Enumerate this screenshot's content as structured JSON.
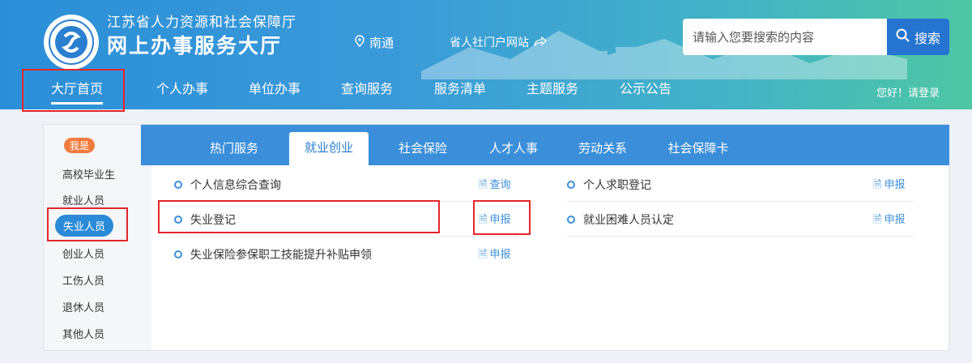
{
  "header": {
    "org_name": "江苏省人力资源和社会保障厅",
    "site_name": "网上办事服务大厅",
    "location": "南通",
    "portal_link": "省人社门户网站",
    "login_text": "您好！请登录"
  },
  "search": {
    "placeholder": "请输入您要搜索的内容",
    "button_label": "搜索"
  },
  "nav": {
    "items": [
      "大厅首页",
      "个人办事",
      "单位办事",
      "查询服务",
      "服务清单",
      "主题服务",
      "公示公告"
    ]
  },
  "sidebar": {
    "badge": "我是",
    "items": [
      "高校毕业生",
      "就业人员",
      "失业人员",
      "创业人员",
      "工伤人员",
      "退休人员",
      "其他人员"
    ]
  },
  "tabs": [
    "热门服务",
    "就业创业",
    "社会保险",
    "人才人事",
    "劳动关系",
    "社会保障卡"
  ],
  "services": [
    {
      "name": "个人信息综合查询",
      "action": "查询"
    },
    {
      "name": "失业登记",
      "action": "申报"
    },
    {
      "name": "失业保险参保职工技能提升补贴申领",
      "action": "申报"
    },
    {
      "name": "个人求职登记",
      "action": "申报"
    },
    {
      "name": "就业困难人员认定",
      "action": "申报"
    }
  ],
  "colors": {
    "accent": "#3b8fda",
    "highlight": "#e3262a",
    "badge": "#f07b3f"
  }
}
